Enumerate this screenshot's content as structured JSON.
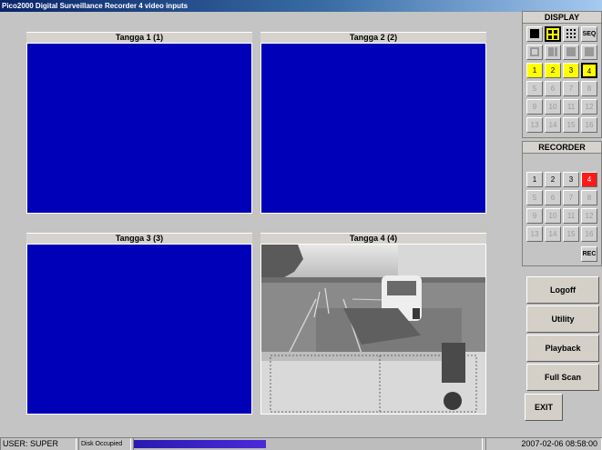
{
  "window": {
    "title": "Pico2000 Digital Surveillance Recorder 4 video inputs"
  },
  "cameras": [
    {
      "label": "Tangga 1 (1)"
    },
    {
      "label": "Tangga 2 (2)"
    },
    {
      "label": "Tangga 3 (3)"
    },
    {
      "label": "Tangga 4 (4)"
    }
  ],
  "display": {
    "header": "DISPLAY",
    "seq_label": "SEQ",
    "channels": [
      "1",
      "2",
      "3",
      "4",
      "5",
      "6",
      "7",
      "8",
      "9",
      "10",
      "11",
      "12",
      "13",
      "14",
      "15",
      "16"
    ]
  },
  "recorder": {
    "header": "RECORDER",
    "channels": [
      "1",
      "2",
      "3",
      "4",
      "5",
      "6",
      "7",
      "8",
      "9",
      "10",
      "11",
      "12",
      "13",
      "14",
      "15",
      "16"
    ],
    "rec_label": "REC"
  },
  "actions": {
    "logoff": "Logoff",
    "utility": "Utility",
    "playback": "Playback",
    "full_scan": "Full Scan",
    "exit": "EXIT"
  },
  "status": {
    "user": "USER: SUPER",
    "disk": "Disk Occupied",
    "disk_fill_fraction": 0.38,
    "datetime": "2007-02-06   08:58:00"
  },
  "colors": {
    "screen_blue": "#0000b8",
    "active_yellow": "#ffff00",
    "record_red": "#ff1a1a",
    "disk_bar": "#4b2ad8"
  }
}
